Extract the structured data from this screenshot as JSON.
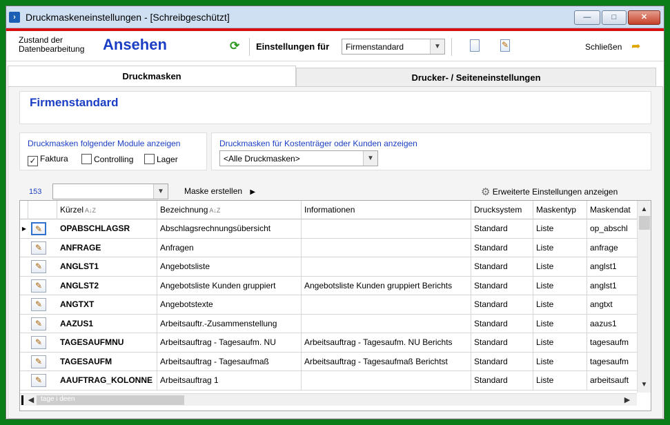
{
  "window": {
    "title": "Druckmaskeneinstellungen - [Schreibgeschützt]",
    "buttons": {
      "minimize": "—",
      "maximize": "□",
      "close": "✕"
    }
  },
  "toolbar": {
    "zustand_label": "Zustand der Datenbearbeitung",
    "mode": "Ansehen",
    "einstellungen_label": "Einstellungen für",
    "einstellungen_value": "Firmenstandard",
    "close_label": "Schließen"
  },
  "tabs": [
    {
      "label": "Druckmasken",
      "active": true
    },
    {
      "label": "Drucker- / Seiteneinstellungen",
      "active": false
    }
  ],
  "header": {
    "title": "Firmenstandard"
  },
  "modules": {
    "title": "Druckmasken folgender Module anzeigen",
    "faktura": {
      "label": "Faktura",
      "checked": true
    },
    "controlling": {
      "label": "Controlling",
      "checked": false
    },
    "lager": {
      "label": "Lager",
      "checked": false
    }
  },
  "kosten": {
    "title": "Druckmasken für Kostenträger oder Kunden anzeigen",
    "value": "<Alle Druckmasken>"
  },
  "list_toolbar": {
    "count": "153",
    "filter_value": "",
    "maske_erstellen": "Maske erstellen",
    "erweiterte": "Erweiterte Einstellungen anzeigen"
  },
  "grid": {
    "columns": {
      "kuerzel": "Kürzel",
      "bezeichnung": "Bezeichnung",
      "informationen": "Informationen",
      "drucksystem": "Drucksystem",
      "maskentyp": "Maskentyp",
      "maskendatei": "Maskendat"
    },
    "rows": [
      {
        "kuerzel": "OPABSCHLAGSR",
        "bezeichnung": "Abschlagsrechnungsübersicht",
        "informationen": "",
        "drucksystem": "Standard",
        "maskentyp": "Liste",
        "maskendatei": "op_abschl"
      },
      {
        "kuerzel": "ANFRAGE",
        "bezeichnung": "Anfragen",
        "informationen": "",
        "drucksystem": "Standard",
        "maskentyp": "Liste",
        "maskendatei": "anfrage"
      },
      {
        "kuerzel": "ANGLST1",
        "bezeichnung": "Angebotsliste",
        "informationen": "",
        "drucksystem": "Standard",
        "maskentyp": "Liste",
        "maskendatei": "anglst1"
      },
      {
        "kuerzel": "ANGLST2",
        "bezeichnung": "Angebotsliste Kunden gruppiert",
        "informationen": "Angebotsliste Kunden gruppiert Berichts",
        "drucksystem": "Standard",
        "maskentyp": "Liste",
        "maskendatei": "anglst1"
      },
      {
        "kuerzel": "ANGTXT",
        "bezeichnung": "Angebotstexte",
        "informationen": "",
        "drucksystem": "Standard",
        "maskentyp": "Liste",
        "maskendatei": "angtxt"
      },
      {
        "kuerzel": "AAZUS1",
        "bezeichnung": "Arbeitsauftr.-Zusammenstellung",
        "informationen": "",
        "drucksystem": "Standard",
        "maskentyp": "Liste",
        "maskendatei": "aazus1"
      },
      {
        "kuerzel": "TAGESAUFMNU",
        "bezeichnung": "Arbeitsauftrag - Tagesaufm. NU",
        "informationen": "Arbeitsauftrag - Tagesaufm. NU Berichts",
        "drucksystem": "Standard",
        "maskentyp": "Liste",
        "maskendatei": "tagesaufm"
      },
      {
        "kuerzel": "TAGESAUFM",
        "bezeichnung": "Arbeitsauftrag - Tagesaufmaß",
        "informationen": "Arbeitsauftrag - Tagesaufmaß Berichtst",
        "drucksystem": "Standard",
        "maskentyp": "Liste",
        "maskendatei": "tagesaufm"
      },
      {
        "kuerzel": "AAUFTRAG_KOLONNE",
        "bezeichnung": "Arbeitsauftrag 1",
        "informationen": "",
        "drucksystem": "Standard",
        "maskentyp": "Liste",
        "maskendatei": "arbeitsauft"
      }
    ]
  },
  "scrollbar": {
    "ghost_text": "tage i deen"
  },
  "colors": {
    "accent": "#1a3ec4",
    "red_line": "#d90f0f",
    "frame": "#0b7d17"
  }
}
